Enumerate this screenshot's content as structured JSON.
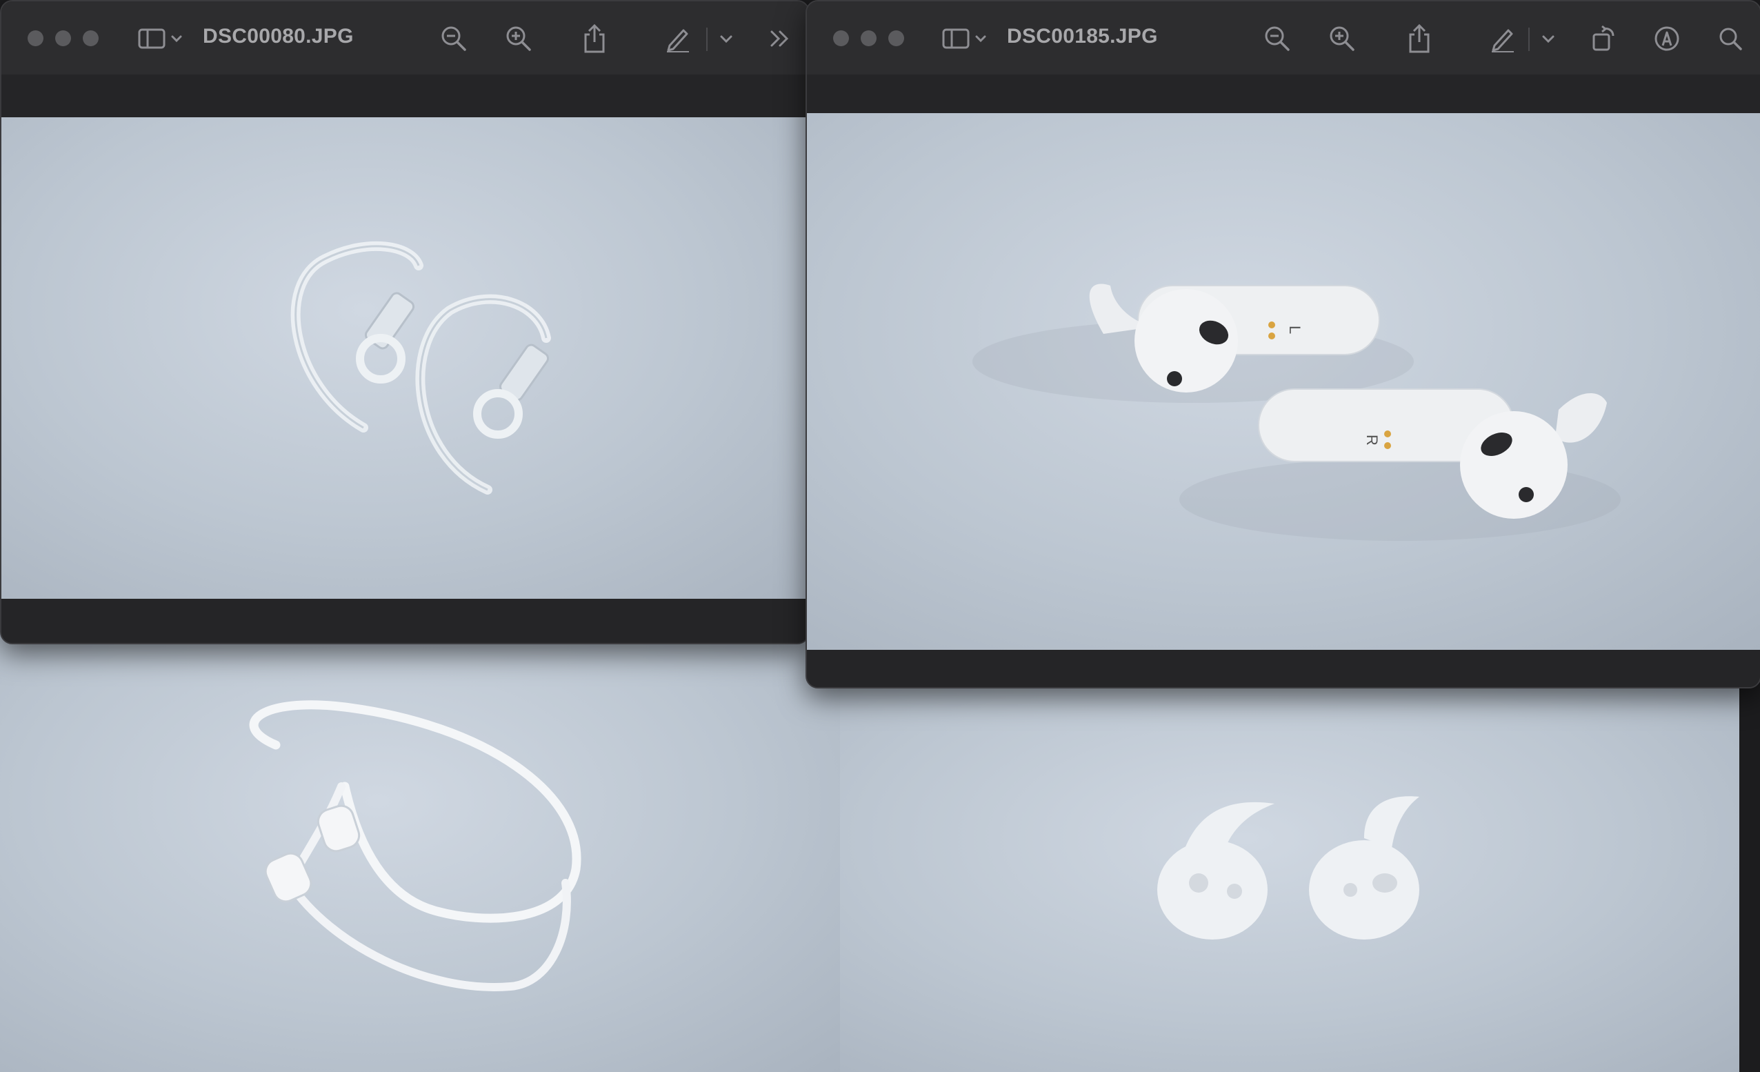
{
  "desktop": {
    "bg_color": "#1c1c1e"
  },
  "windows": [
    {
      "title": "DSC00080.JPG",
      "toolbar_icons": [
        "sidebar-toggle-icon",
        "chevron-down-icon",
        "zoom-out-icon",
        "zoom-in-icon",
        "share-icon",
        "markup-pen-icon",
        "chevron-down-icon",
        "more-chevrons-icon"
      ],
      "photo_subject": "clear ear hooks"
    },
    {
      "title": "DSC00185.JPG",
      "toolbar_icons": [
        "sidebar-toggle-icon",
        "chevron-down-icon",
        "zoom-out-icon",
        "zoom-in-icon",
        "share-icon",
        "markup-pen-icon",
        "chevron-down-icon",
        "rotate-icon",
        "markup-circle-icon",
        "search-icon"
      ],
      "photo_subject": "white earbuds with wing tips",
      "earbud_labels": [
        "L",
        "R"
      ]
    }
  ],
  "background_photos": [
    {
      "subject": "white anti-lost strap"
    },
    {
      "subject": "white ear tips with fins"
    }
  ],
  "accent_colors": {
    "traffic_light": "#5b5b5e",
    "icon": "#8e8e93",
    "charging_pin": "#d9a441"
  }
}
